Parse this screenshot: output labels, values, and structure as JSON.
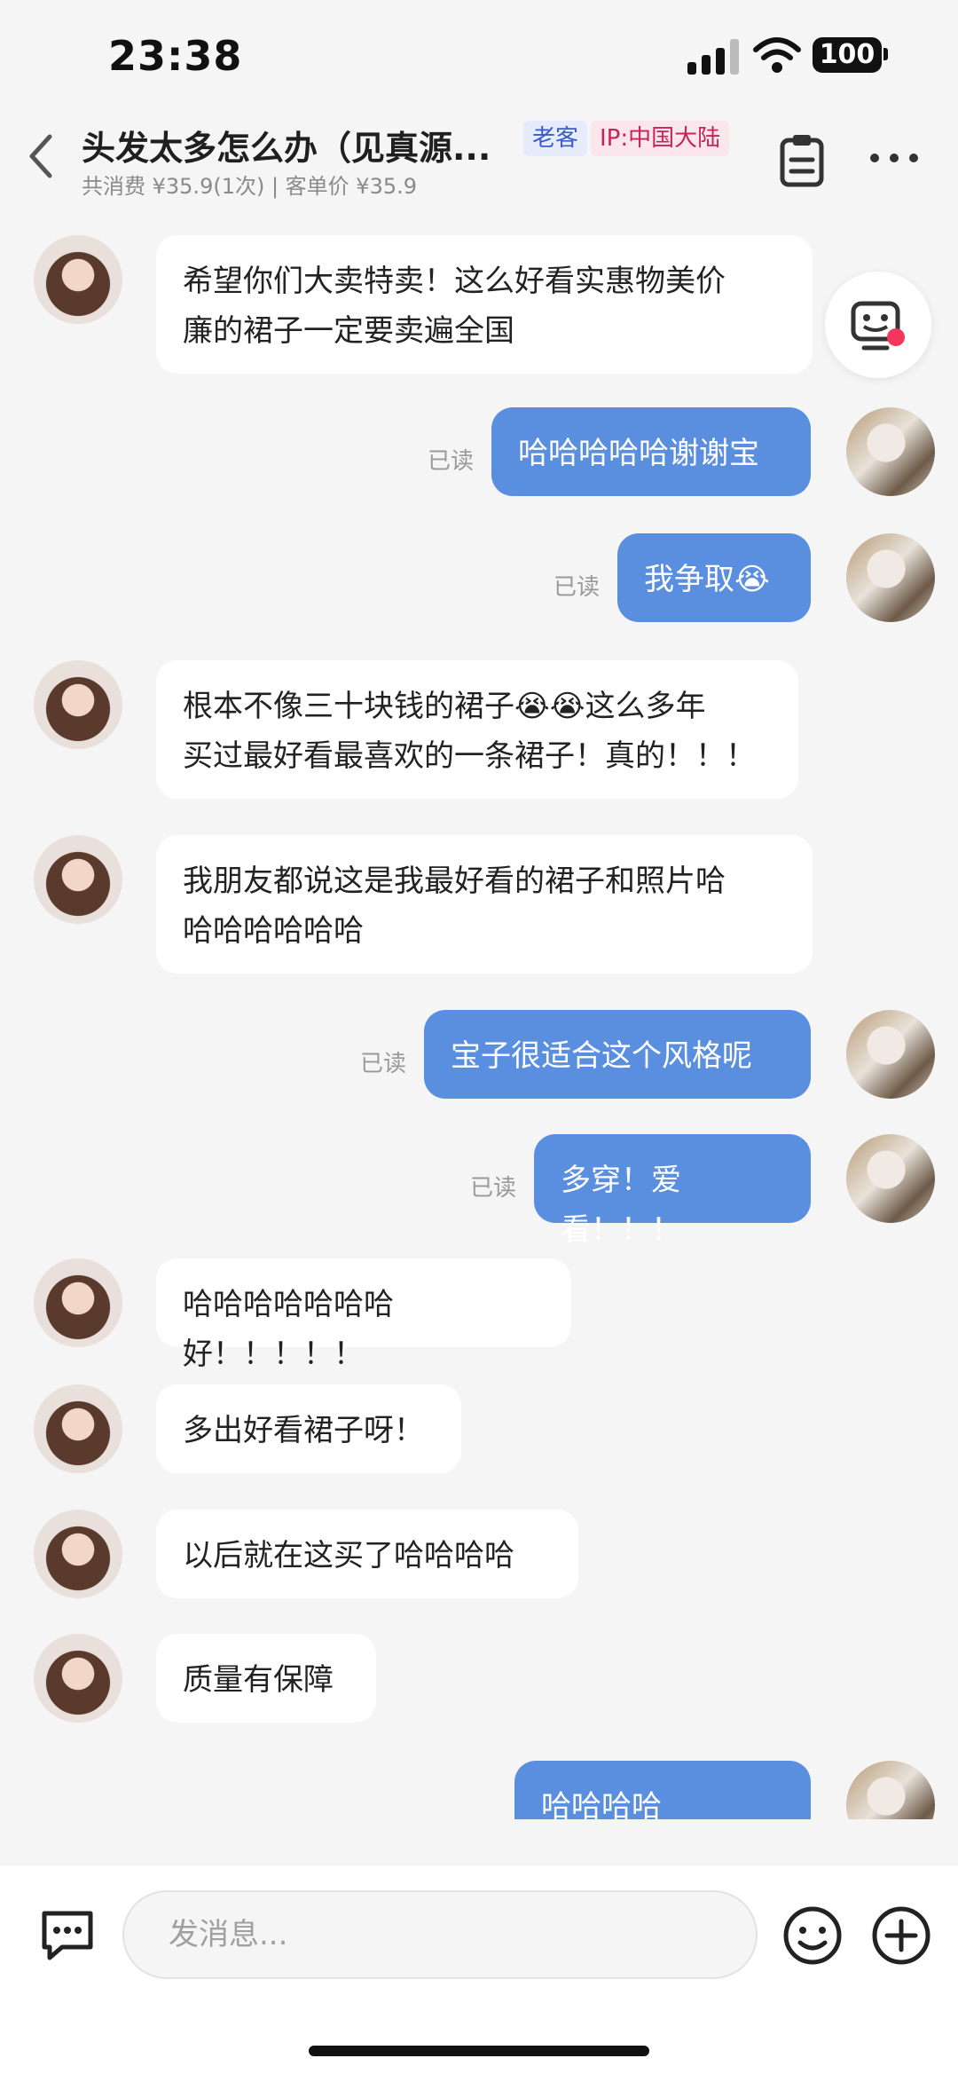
{
  "status_bar": {
    "time": "23:38",
    "battery": "100"
  },
  "header": {
    "title": "头发太多怎么办（见真源...",
    "badge_customer": "老客",
    "badge_ip": "IP:中国大陆",
    "subtitle": "共消费 ¥35.9(1次) | 客单价 ¥35.9"
  },
  "messages": [
    {
      "from": "customer",
      "text": "希望你们大卖特卖！这么好看实惠物美价\n廉的裙子一定要卖遍全国"
    },
    {
      "from": "seller",
      "text": "哈哈哈哈哈谢谢宝",
      "status": "已读"
    },
    {
      "from": "seller",
      "text": "我争取😭",
      "status": "已读"
    },
    {
      "from": "customer",
      "text": "根本不像三十块钱的裙子😭😭这么多年\n买过最好看最喜欢的一条裙子！真的！！！"
    },
    {
      "from": "customer",
      "text": "我朋友都说这是我最好看的裙子和照片哈\n哈哈哈哈哈哈"
    },
    {
      "from": "seller",
      "text": "宝子很适合这个风格呢",
      "status": "已读"
    },
    {
      "from": "seller",
      "text": "多穿！爱看！！！",
      "status": "已读"
    },
    {
      "from": "customer",
      "text": "哈哈哈哈哈哈哈好！！！！！"
    },
    {
      "from": "customer",
      "text": "多出好看裙子呀！"
    },
    {
      "from": "customer",
      "text": "以后就在这买了哈哈哈哈"
    },
    {
      "from": "customer",
      "text": "质量有保障"
    },
    {
      "from": "seller",
      "text": "哈哈哈哈好！！！！"
    }
  ],
  "input": {
    "placeholder": "发消息..."
  },
  "colors": {
    "seller_bubble": "#5a8fe0",
    "customer_bubble": "#ffffff",
    "background": "#f5f5f5"
  },
  "icons": [
    "back-icon",
    "clipboard-icon",
    "more-icon",
    "robot-icon",
    "chat-menu-icon",
    "emoji-icon",
    "plus-icon"
  ]
}
